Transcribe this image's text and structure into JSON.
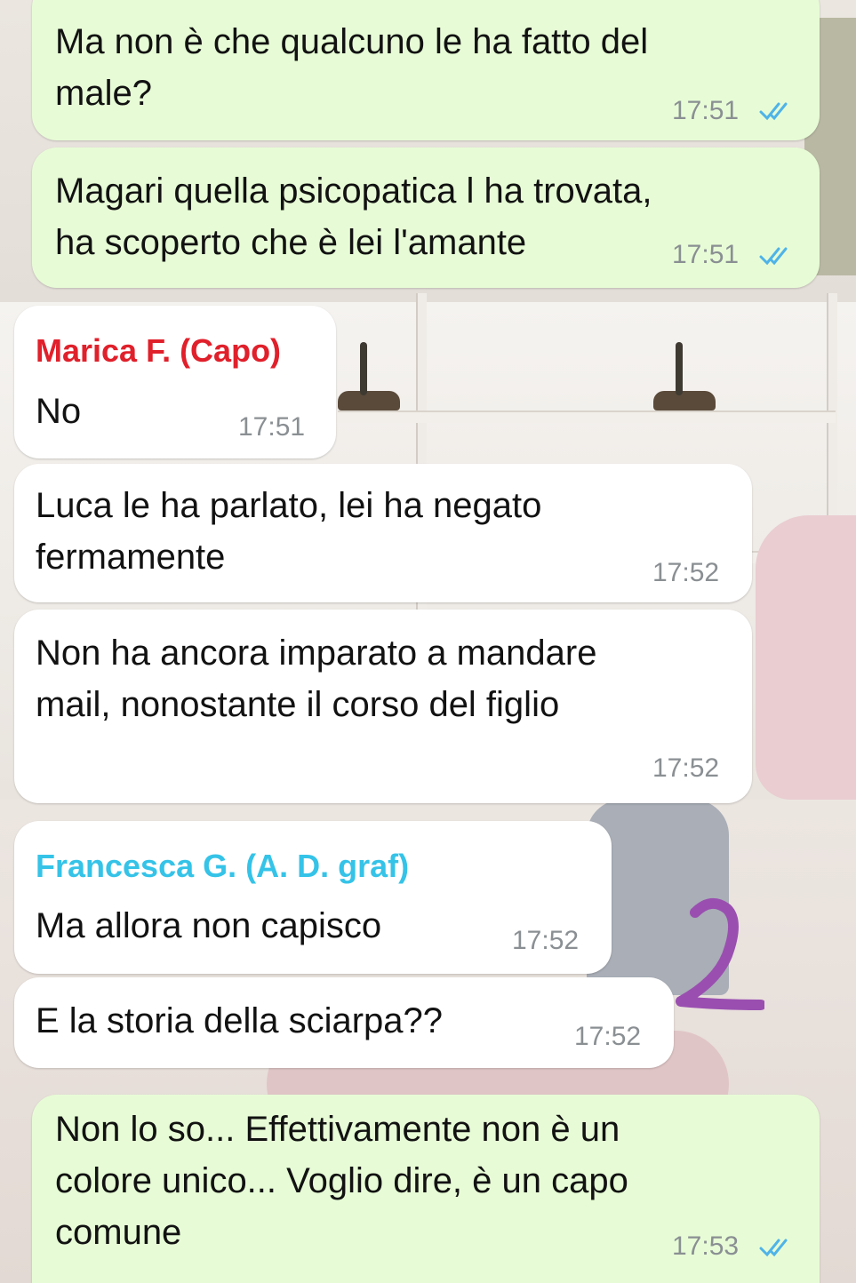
{
  "colors": {
    "outgoing_bubble": "#e7fcd6",
    "incoming_bubble": "#ffffff",
    "read_ticks": "#4fb3e8",
    "timestamp": "#8a8f93",
    "sender_marica": "#e0202b",
    "sender_francesca": "#35c3e8",
    "annotation_mark": "#9a4fb0"
  },
  "messages": [
    {
      "direction": "out",
      "text": "Ma non è che qualcuno le ha fatto del\nmale?",
      "time": "17:51",
      "status_icon": "double-check-read-icon"
    },
    {
      "direction": "out",
      "text": "Magari quella psicopatica l ha trovata,\nha scoperto che è lei l'amante",
      "time": "17:51",
      "status_icon": "double-check-read-icon"
    },
    {
      "direction": "in",
      "sender": "Marica F. (Capo)",
      "text": "No",
      "time": "17:51"
    },
    {
      "direction": "in",
      "text": "Luca le ha parlato, lei ha negato\nfermamente",
      "time": "17:52"
    },
    {
      "direction": "in",
      "text": "Non ha ancora imparato a mandare\nmail, nonostante il corso del figlio",
      "time": "17:52"
    },
    {
      "direction": "in",
      "sender": "Francesca G. (A. D. graf)",
      "text": "Ma allora non capisco",
      "time": "17:52"
    },
    {
      "direction": "in",
      "text": "E la storia della sciarpa??",
      "time": "17:52"
    },
    {
      "direction": "out",
      "text": "Non lo so... Effettivamente non è un\ncolore unico... Voglio dire, è un capo\ncomune",
      "time": "17:53",
      "status_icon": "double-check-read-icon"
    }
  ],
  "annotation": {
    "text": "2"
  }
}
